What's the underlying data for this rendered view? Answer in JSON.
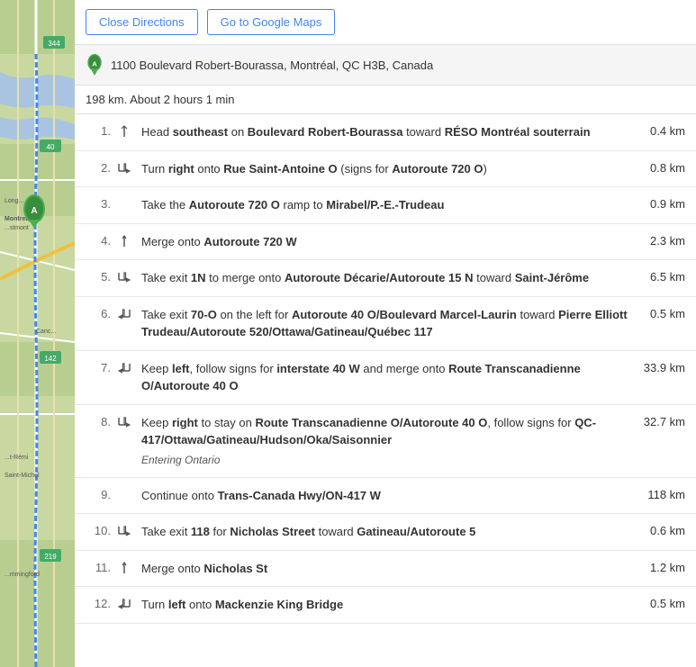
{
  "buttons": {
    "close_directions": "Close Directions",
    "go_to_google_maps": "Go to Google Maps"
  },
  "origin": {
    "label": "A",
    "address": "1100 Boulevard Robert-Bourassa, Montréal, QC H3B, Canada"
  },
  "summary": "198 km. About 2 hours 1 min",
  "steps": [
    {
      "num": "1.",
      "icon": "straight",
      "text_before": "Head ",
      "bold1": "southeast",
      "text_mid1": " on ",
      "bold2": "Boulevard Robert-Bourassa",
      "text_mid2": " toward ",
      "bold3": "RÉSO Montréal souterrain",
      "text_after": "",
      "note": "",
      "entering": "",
      "distance": "0.4 km"
    },
    {
      "num": "2.",
      "icon": "turn-right",
      "text_before": "Turn ",
      "bold1": "right",
      "text_mid1": " onto ",
      "bold2": "Rue Saint-Antoine O",
      "text_mid2": " (signs for ",
      "bold3": "Autoroute 720 O",
      "text_after": ")",
      "note": "",
      "entering": "",
      "distance": "0.8 km"
    },
    {
      "num": "3.",
      "icon": "none",
      "text_before": "Take the ",
      "bold1": "Autoroute 720 O",
      "text_mid1": " ramp to ",
      "bold2": "Mirabel/P.-E.-Trudeau",
      "text_mid2": "",
      "bold3": "",
      "text_after": "",
      "note": "",
      "entering": "",
      "distance": "0.9 km"
    },
    {
      "num": "4.",
      "icon": "merge",
      "text_before": "Merge onto ",
      "bold1": "Autoroute 720 W",
      "text_mid1": "",
      "bold2": "",
      "text_mid2": "",
      "bold3": "",
      "text_after": "",
      "note": "",
      "entering": "",
      "distance": "2.3 km"
    },
    {
      "num": "5.",
      "icon": "turn-right",
      "text_before": "Take exit ",
      "bold1": "1N",
      "text_mid1": " to merge onto ",
      "bold2": "Autoroute Décarie/Autoroute 15 N",
      "text_mid2": " toward ",
      "bold3": "Saint-Jérôme",
      "text_after": "",
      "note": "",
      "entering": "",
      "distance": "6.5 km"
    },
    {
      "num": "6.",
      "icon": "turn-left",
      "text_before": "Take exit ",
      "bold1": "70-O",
      "text_mid1": " on the left for ",
      "bold2": "Autoroute 40 O/Boulevard Marcel-Laurin",
      "text_mid2": " toward ",
      "bold3": "Pierre Elliott Trudeau/Autoroute 520/Ottawa/Gatineau/Québec 117",
      "text_after": "",
      "note": "",
      "entering": "",
      "distance": "0.5 km"
    },
    {
      "num": "7.",
      "icon": "turn-left",
      "text_before": "Keep ",
      "bold1": "left",
      "text_mid1": ", follow signs for ",
      "bold2": "interstate 40 W",
      "text_mid2": " and merge onto ",
      "bold3": "Route Transcanadienne O/Autoroute 40 O",
      "text_after": "",
      "note": "",
      "entering": "",
      "distance": "33.9 km"
    },
    {
      "num": "8.",
      "icon": "turn-right",
      "text_before": "Keep ",
      "bold1": "right",
      "text_mid1": " to stay on ",
      "bold2": "Route Transcanadienne O/Autoroute 40 O",
      "text_mid2": ", follow signs for ",
      "bold3": "QC-417/Ottawa/Gatineau/Hudson/Oka/Saisonnier",
      "text_after": "",
      "note": "",
      "entering": "Entering Ontario",
      "distance": "32.7 km"
    },
    {
      "num": "9.",
      "icon": "none",
      "text_before": "Continue onto ",
      "bold1": "Trans-Canada Hwy/ON-417 W",
      "text_mid1": "",
      "bold2": "",
      "text_mid2": "",
      "bold3": "",
      "text_after": "",
      "note": "",
      "entering": "",
      "distance": "118 km"
    },
    {
      "num": "10.",
      "icon": "turn-right",
      "text_before": "Take exit ",
      "bold1": "118",
      "text_mid1": " for ",
      "bold2": "Nicholas Street",
      "text_mid2": " toward ",
      "bold3": "Gatineau/Autoroute 5",
      "text_after": "",
      "note": "",
      "entering": "",
      "distance": "0.6 km"
    },
    {
      "num": "11.",
      "icon": "merge",
      "text_before": "Merge onto ",
      "bold1": "Nicholas St",
      "text_mid1": "",
      "bold2": "",
      "text_mid2": "",
      "bold3": "",
      "text_after": "",
      "note": "",
      "entering": "",
      "distance": "1.2 km"
    },
    {
      "num": "12.",
      "icon": "turn-left",
      "text_before": "Turn ",
      "bold1": "left",
      "text_mid1": " onto ",
      "bold2": "Mackenzie King Bridge",
      "text_mid2": "",
      "bold3": "",
      "text_after": "",
      "note": "",
      "entering": "",
      "distance": "0.5 km"
    }
  ]
}
